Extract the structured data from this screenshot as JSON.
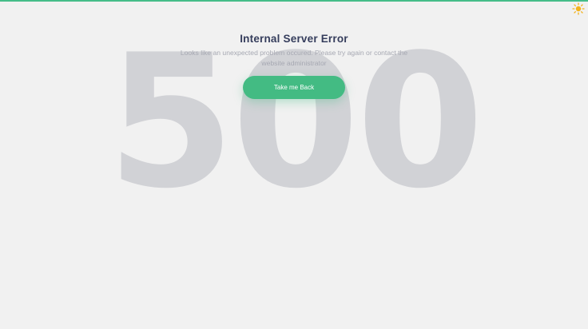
{
  "error": {
    "code": "500",
    "title": "Internal Server Error",
    "message": "Looks like an unexpected problem occured. Please try again or contact the website administrator"
  },
  "actions": {
    "back_label": "Take me Back"
  },
  "theme_toggle": {
    "icon": "sun-icon"
  },
  "colors": {
    "accent": "#45bd88",
    "title": "#353d5c",
    "background_code": "#d1d2d6",
    "page_background": "#f1f1f1"
  }
}
